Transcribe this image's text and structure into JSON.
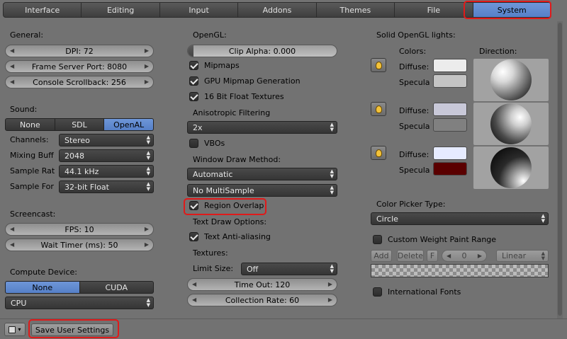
{
  "tabs": [
    {
      "label": "Interface"
    },
    {
      "label": "Editing"
    },
    {
      "label": "Input"
    },
    {
      "label": "Addons"
    },
    {
      "label": "Themes"
    },
    {
      "label": "File"
    },
    {
      "label": "System",
      "active": true
    }
  ],
  "general": {
    "heading": "General:",
    "dpi": "DPI: 72",
    "frame_server_port": "Frame Server Port: 8080",
    "console_scrollback": "Console Scrollback: 256"
  },
  "sound": {
    "heading": "Sound:",
    "options": [
      "None",
      "SDL",
      "OpenAL"
    ],
    "selected": "OpenAL",
    "channels_label": "Channels:",
    "channels_value": "Stereo",
    "mixing_label": "Mixing Buff",
    "mixing_value": "2048",
    "sample_rate_label": "Sample Rat",
    "sample_rate_value": "44.1 kHz",
    "sample_format_label": "Sample For",
    "sample_format_value": "32-bit Float"
  },
  "screencast": {
    "heading": "Screencast:",
    "fps": "FPS: 10",
    "wait_timer": "Wait Timer (ms): 50"
  },
  "compute": {
    "heading": "Compute Device:",
    "options": [
      "None",
      "CUDA"
    ],
    "selected": "None",
    "device": "CPU"
  },
  "opengl": {
    "heading": "OpenGL:",
    "clip_alpha": "Clip Alpha: 0.000",
    "mipmaps": "Mipmaps",
    "gpu_mipmap": "GPU Mipmap Generation",
    "float_textures": "16 Bit Float Textures",
    "aniso_label": "Anisotropic Filtering",
    "aniso_value": "2x",
    "vbos": "VBOs",
    "window_draw_label": "Window Draw Method:",
    "window_draw_value": "Automatic",
    "multisample_value": "No MultiSample",
    "region_overlap": "Region Overlap"
  },
  "text_draw": {
    "heading": "Text Draw Options:",
    "anti_aliasing": "Text Anti-aliasing"
  },
  "textures": {
    "heading": "Textures:",
    "limit_label": "Limit Size:",
    "limit_value": "Off",
    "timeout": "Time Out: 120",
    "collection_rate": "Collection Rate: 60"
  },
  "lights": {
    "heading": "Solid OpenGL lights:",
    "colors_label": "Colors:",
    "direction_label": "Direction:",
    "diffuse_label": "Diffuse:",
    "specular_label": "Specula",
    "diffuse_colors": [
      "#ececec",
      "#c8c8d8",
      "#e6ebff"
    ],
    "specular_colors": [
      "#c4c4c4",
      "#808080",
      "#5a0000"
    ]
  },
  "color_picker": {
    "heading": "Color Picker Type:",
    "value": "Circle"
  },
  "weight_paint": {
    "label": "Custom Weight Paint Range",
    "add": "Add",
    "delete": "Delete",
    "f": "F",
    "index": "0",
    "interp": "Linear"
  },
  "intl_fonts": "International Fonts",
  "bottom": {
    "save_label": "Save User Settings"
  },
  "colors": {
    "accent": "#5f89cf",
    "highlight": "#e01a1a"
  }
}
